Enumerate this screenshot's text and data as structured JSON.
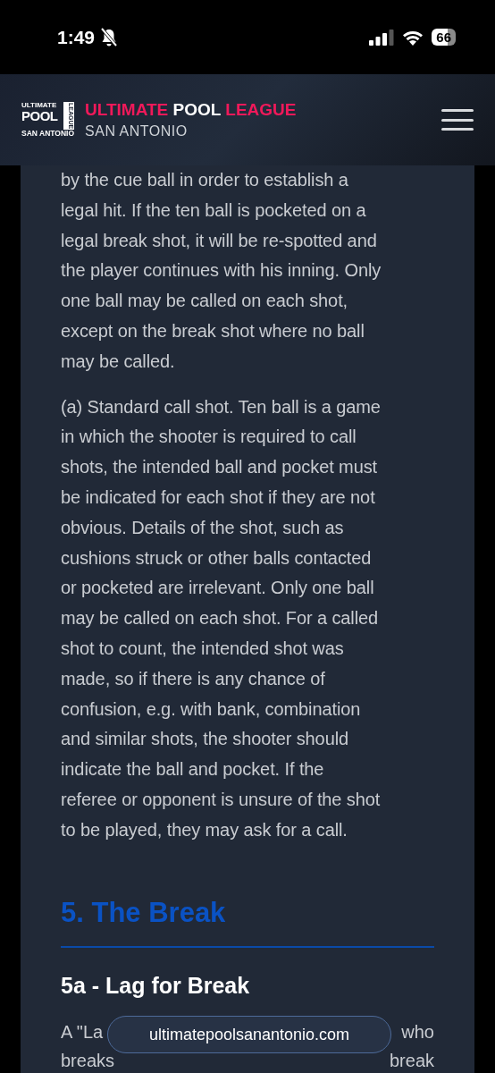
{
  "status_bar": {
    "time": "1:49",
    "silent": true,
    "battery": "66"
  },
  "header": {
    "logo": {
      "top": "ULTIMATE",
      "middle": "POOL",
      "side": "LEAGUE",
      "bottom": "SAN ANTONIO"
    },
    "title_parts": [
      {
        "text": "ULTIMATE",
        "color": "#f0195a"
      },
      {
        "text": "POOL",
        "color": "#ffffff"
      },
      {
        "text": "LEAGUE",
        "color": "#f0195a"
      }
    ],
    "subtitle": "SAN ANTONIO"
  },
  "content": [
    {
      "kind": "paragraph",
      "lines": [
        "by the cue ball in order to establish a",
        "legal hit. If the ten ball is pocketed on a",
        "legal break shot, it will be re-spotted and",
        "the player continues with his inning. Only",
        "one ball may be called on each shot,",
        "except on the break shot where no ball",
        "may be called."
      ]
    },
    {
      "kind": "paragraph",
      "lines": [
        "(a) Standard call shot. Ten ball is a game",
        "in which the shooter is required to call",
        "shots, the intended ball and pocket must",
        "be indicated for each shot if they are not",
        "obvious. Details of the shot, such as",
        "cushions struck or other balls contacted",
        "or pocketed are irrelevant. Only one ball",
        "may be called on each shot. For a called",
        "shot to count, the intended shot was",
        "made, so if there is any chance of",
        "confusion, e.g. with bank, combination",
        "and similar shots, the shooter should",
        "indicate the ball and pocket. If the",
        "referee or opponent is unsure of the shot",
        "to be played, they may ask for a call."
      ]
    },
    {
      "kind": "section_heading",
      "text": "5. The Break"
    },
    {
      "kind": "subheading",
      "text": "5a - Lag for Break"
    },
    {
      "kind": "covered_paragraph",
      "lines": [
        {
          "left": "A \"La",
          "right": "who"
        },
        {
          "left": "breaks",
          "right": "break"
        }
      ]
    }
  ],
  "url_bar": {
    "url": "ultimatepoolsanantonio.com"
  }
}
